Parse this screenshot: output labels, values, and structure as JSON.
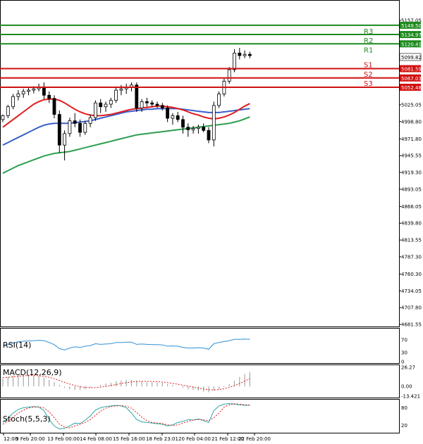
{
  "chart_data": {
    "type": "candlestick",
    "main": {
      "ylim": [
        4681.55,
        5157.05
      ],
      "y_ticks": [
        "5157.05",
        "5149.50",
        "5134.97",
        "5120.41",
        "5099.82",
        "5081.59",
        "5067.03",
        "5052.48",
        "5025.05",
        "4998.80",
        "4971.80",
        "4945.55",
        "4919.30",
        "4893.05",
        "4866.05",
        "4839.80",
        "4813.55",
        "4787.30",
        "4760.30",
        "4734.05",
        "4707.80",
        "4681.55"
      ],
      "x_ticks": [
        "12:00",
        "9 Feb 20:00",
        "13 Feb 00:00",
        "14 Feb 08:00",
        "15 Feb 16:00",
        "18 Feb 23:01",
        "20 Feb 04:00",
        "21 Feb 12:00",
        "22 Feb 20:00"
      ],
      "candles": [
        [
          5002,
          5010,
          4998,
          5008
        ],
        [
          5008,
          5025,
          5004,
          5022
        ],
        [
          5022,
          5042,
          5018,
          5038
        ],
        [
          5038,
          5048,
          5032,
          5042
        ],
        [
          5042,
          5050,
          5036,
          5046
        ],
        [
          5046,
          5052,
          5040,
          5048
        ],
        [
          5048,
          5054,
          5043,
          5050
        ],
        [
          5050,
          5058,
          5046,
          5052
        ],
        [
          5052,
          5060,
          5034,
          5040
        ],
        [
          5040,
          5046,
          5028,
          5035
        ],
        [
          5035,
          5040,
          5004,
          5010
        ],
        [
          5010,
          5016,
          4950,
          4962
        ],
        [
          4962,
          4985,
          4938,
          4980
        ],
        [
          4980,
          5005,
          4975,
          5000
        ],
        [
          5000,
          5012,
          4990,
          4996
        ],
        [
          4996,
          5002,
          4975,
          4982
        ],
        [
          4982,
          5000,
          4978,
          4996
        ],
        [
          4996,
          5010,
          4990,
          5005
        ],
        [
          5005,
          5032,
          5000,
          5028
        ],
        [
          5028,
          5034,
          5012,
          5022
        ],
        [
          5022,
          5030,
          5014,
          5026
        ],
        [
          5026,
          5036,
          5020,
          5032
        ],
        [
          5032,
          5052,
          5028,
          5048
        ],
        [
          5048,
          5056,
          5040,
          5050
        ],
        [
          5050,
          5058,
          5042,
          5053
        ],
        [
          5053,
          5060,
          5046,
          5056
        ],
        [
          5056,
          5060,
          5014,
          5020
        ],
        [
          5020,
          5034,
          5014,
          5030
        ],
        [
          5030,
          5036,
          5022,
          5028
        ],
        [
          5028,
          5032,
          5022,
          5026
        ],
        [
          5026,
          5030,
          5020,
          5024
        ],
        [
          5024,
          5028,
          5016,
          5020
        ],
        [
          5020,
          5024,
          4998,
          5004
        ],
        [
          5004,
          5012,
          4994,
          5008
        ],
        [
          5008,
          5014,
          4998,
          5002
        ],
        [
          5002,
          5008,
          4980,
          4990
        ],
        [
          4990,
          4996,
          4975,
          4986
        ],
        [
          4986,
          4992,
          4980,
          4988
        ],
        [
          4988,
          4994,
          4980,
          4990
        ],
        [
          4990,
          4996,
          4982,
          4985
        ],
        [
          4985,
          4990,
          4965,
          4970
        ],
        [
          4970,
          5030,
          4960,
          5024
        ],
        [
          5024,
          5046,
          5020,
          5042
        ],
        [
          5042,
          5066,
          5038,
          5062
        ],
        [
          5062,
          5084,
          5058,
          5080
        ],
        [
          5080,
          5112,
          5076,
          5106
        ],
        [
          5106,
          5114,
          5096,
          5102
        ],
        [
          5102,
          5110,
          5098,
          5104
        ],
        [
          5104,
          5108,
          5098,
          5102
        ]
      ],
      "ma_red": [
        4990,
        4996,
        5002,
        5008,
        5014,
        5020,
        5026,
        5030,
        5033,
        5034,
        5034,
        5032,
        5028,
        5023,
        5018,
        5014,
        5011,
        5009,
        5008,
        5008,
        5009,
        5010,
        5012,
        5014,
        5016,
        5018,
        5019,
        5020,
        5021,
        5022,
        5023,
        5023,
        5022,
        5021,
        5019,
        5017,
        5014,
        5011,
        5009,
        5006,
        5004,
        5003,
        5004,
        5006,
        5009,
        5013,
        5018,
        5023,
        5027
      ],
      "ma_blue": [
        4962,
        4966,
        4970,
        4974,
        4978,
        4982,
        4986,
        4990,
        4993,
        4995,
        4996,
        4996,
        4996,
        4996,
        4997,
        4998,
        4999,
        5000,
        5002,
        5004,
        5006,
        5008,
        5010,
        5012,
        5014,
        5015,
        5016,
        5017,
        5018,
        5018,
        5019,
        5019,
        5019,
        5019,
        5019,
        5018,
        5017,
        5016,
        5015,
        5014,
        5013,
        5013,
        5013,
        5014,
        5015,
        5016,
        5017,
        5018,
        5019
      ],
      "ma_green": [
        4918,
        4922,
        4926,
        4930,
        4933,
        4936,
        4939,
        4942,
        4945,
        4947,
        4949,
        4950,
        4951,
        4952,
        4954,
        4956,
        4958,
        4960,
        4962,
        4964,
        4966,
        4968,
        4970,
        4972,
        4974,
        4976,
        4978,
        4979,
        4980,
        4981,
        4982,
        4983,
        4984,
        4985,
        4986,
        4987,
        4988,
        4989,
        4990,
        4991,
        4992,
        4993,
        4994,
        4995,
        4996,
        4998,
        5000,
        5003,
        5006
      ],
      "levels": [
        {
          "name": "R3",
          "value": 5149.5,
          "label": "5149.50",
          "color": "#1e8a1e"
        },
        {
          "name": "R2",
          "value": 5134.97,
          "label": "5134.97",
          "color": "#1e8a1e"
        },
        {
          "name": "R1",
          "value": 5120.41,
          "label": "5120.41",
          "color": "#1e8a1e"
        },
        {
          "name": "S1",
          "value": 5081.59,
          "label": "5081.59",
          "color": "#d01010"
        },
        {
          "name": "S2",
          "value": 5067.03,
          "label": "5067.03",
          "color": "#d01010"
        },
        {
          "name": "S3",
          "value": 5052.48,
          "label": "5052.48",
          "color": "#d01010"
        }
      ],
      "last_price": "5099.82"
    },
    "rsi": {
      "title": "RSI(14)",
      "ylim": [
        0,
        100
      ],
      "y_ticks": [
        "70",
        "30",
        "0"
      ],
      "values": [
        52,
        55,
        60,
        64,
        66,
        67,
        68,
        69,
        68,
        62,
        55,
        42,
        38,
        44,
        48,
        46,
        50,
        52,
        58,
        56,
        57,
        58,
        62,
        62,
        63,
        63,
        56,
        57,
        56,
        55,
        55,
        54,
        50,
        51,
        50,
        46,
        44,
        44,
        45,
        44,
        40,
        58,
        62,
        65,
        68,
        72,
        72,
        73,
        72
      ]
    },
    "macd": {
      "title": "MACD(12,26,9)",
      "y_ticks": [
        "26.27",
        "0.00",
        "-13.421"
      ],
      "ylim": [
        -13.421,
        26.27
      ],
      "hist": [
        11,
        13,
        15,
        16,
        16,
        16,
        15,
        14,
        12,
        9,
        6,
        2,
        -2,
        -4,
        -5,
        -5,
        -4,
        -2,
        0,
        2,
        4,
        5,
        7,
        8,
        9,
        9,
        8,
        7,
        6,
        6,
        5,
        5,
        3,
        2,
        0,
        -2,
        -4,
        -5,
        -6,
        -7,
        -8,
        -6,
        -4,
        -1,
        3,
        8,
        13,
        17,
        20
      ],
      "signal": [
        12,
        12.5,
        13.2,
        14,
        14.6,
        15,
        15,
        14.6,
        13.8,
        12.4,
        10.6,
        8.2,
        5.6,
        3.2,
        1.2,
        -0.4,
        -1.4,
        -1.8,
        -1.6,
        -0.9,
        0,
        1.2,
        2.6,
        4,
        5.2,
        6.2,
        6.8,
        7,
        7,
        6.8,
        6.4,
        5.9,
        5.2,
        4.2,
        3,
        1.7,
        0.3,
        -1,
        -2.3,
        -3.5,
        -4.5,
        -4.8,
        -4.4,
        -3.3,
        -1.5,
        1,
        4,
        7.3,
        10.8
      ]
    },
    "stoch": {
      "title": "Stoch(5,5,3)",
      "ylim": [
        0,
        100
      ],
      "y_ticks": [
        "80",
        "20"
      ],
      "k": [
        30,
        45,
        62,
        74,
        80,
        82,
        84,
        82,
        70,
        40,
        18,
        8,
        10,
        18,
        28,
        26,
        38,
        52,
        72,
        80,
        84,
        86,
        88,
        86,
        80,
        62,
        40,
        32,
        30,
        28,
        26,
        24,
        18,
        22,
        30,
        34,
        40,
        38,
        42,
        36,
        30,
        70,
        86,
        92,
        94,
        92,
        90,
        88,
        88
      ],
      "d": [
        24,
        34,
        48,
        62,
        72,
        79,
        82,
        83,
        79,
        66,
        46,
        24,
        14,
        12,
        18,
        24,
        30,
        40,
        54,
        68,
        78,
        84,
        86,
        87,
        85,
        78,
        64,
        48,
        36,
        30,
        28,
        26,
        22,
        20,
        22,
        28,
        34,
        38,
        40,
        39,
        36,
        46,
        62,
        82,
        90,
        93,
        92,
        90,
        89
      ]
    }
  }
}
